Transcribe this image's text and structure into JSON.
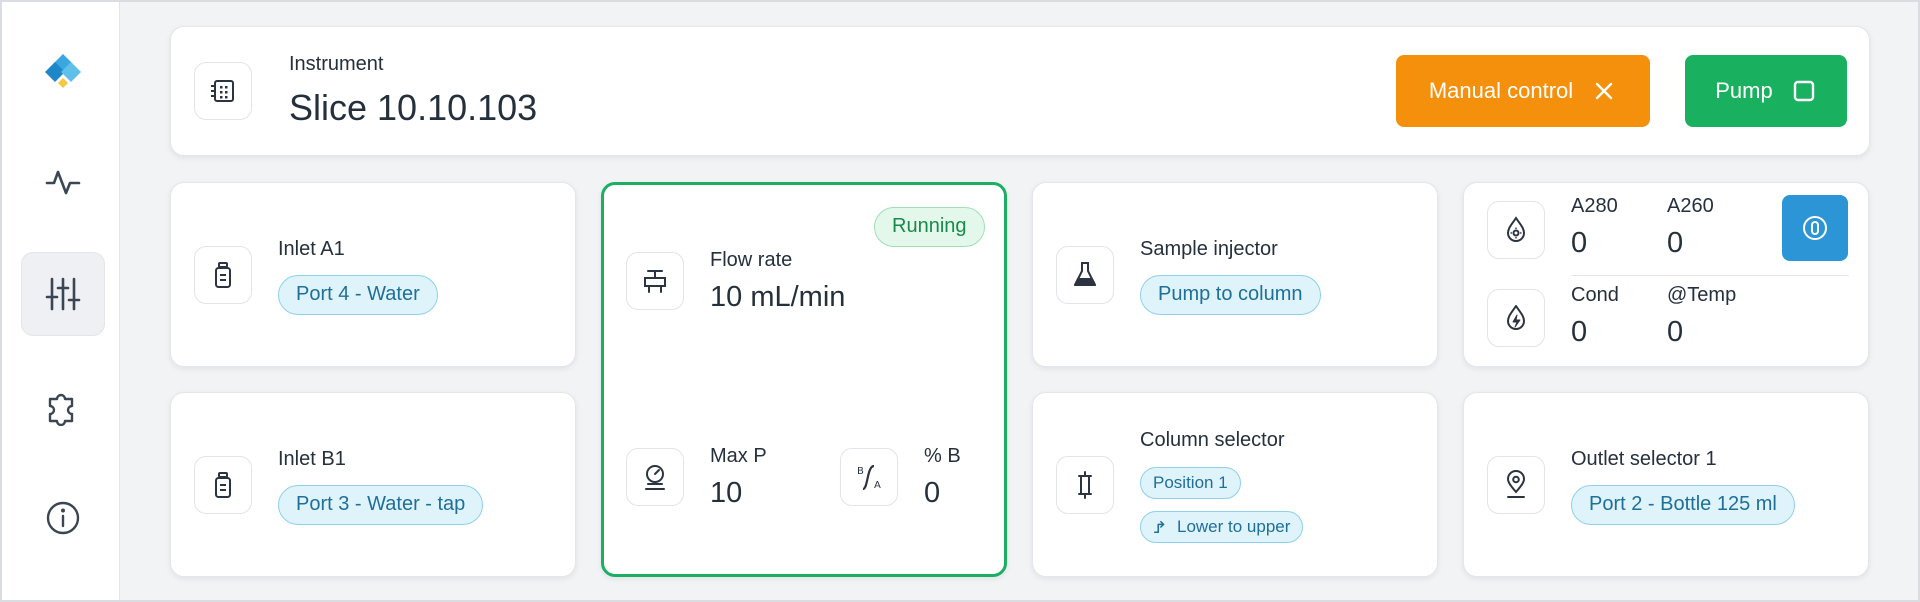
{
  "header": {
    "label": "Instrument",
    "title": "Slice 10.10.103",
    "manual_control_label": "Manual control",
    "pump_label": "Pump"
  },
  "sidebar": {
    "items": [
      {
        "icon": "logo-icon"
      },
      {
        "icon": "activity-icon"
      },
      {
        "icon": "sliders-icon",
        "active": true
      },
      {
        "icon": "puzzle-icon"
      },
      {
        "icon": "info-icon"
      }
    ]
  },
  "cards": {
    "inlet_a": {
      "label": "Inlet A1",
      "port": "Port 4 - Water"
    },
    "inlet_b": {
      "label": "Inlet B1",
      "port": "Port 3 - Water - tap"
    },
    "flow": {
      "status": "Running",
      "flow_label": "Flow rate",
      "flow_value": "10 mL/min",
      "maxp_label": "Max P",
      "maxp_value": "10",
      "pctb_label": "% B",
      "pctb_value": "0"
    },
    "sample_injector": {
      "label": "Sample injector",
      "mode": "Pump to column"
    },
    "column_selector": {
      "label": "Column selector",
      "position": "Position 1",
      "direction": "Lower to upper"
    },
    "sensors": {
      "a280_label": "A280",
      "a280_value": "0",
      "a260_label": "A260",
      "a260_value": "0",
      "cond_label": "Cond",
      "cond_value": "0",
      "temp_label": "@Temp",
      "temp_value": "0"
    },
    "outlet": {
      "label": "Outlet selector 1",
      "port": "Port 2 - Bottle 125 ml"
    }
  },
  "colors": {
    "accent_orange": "#f5900c",
    "accent_green": "#19b15f",
    "accent_blue": "#2c95d6",
    "pill_bg": "#dff3fb",
    "pill_text": "#1f6f98"
  }
}
